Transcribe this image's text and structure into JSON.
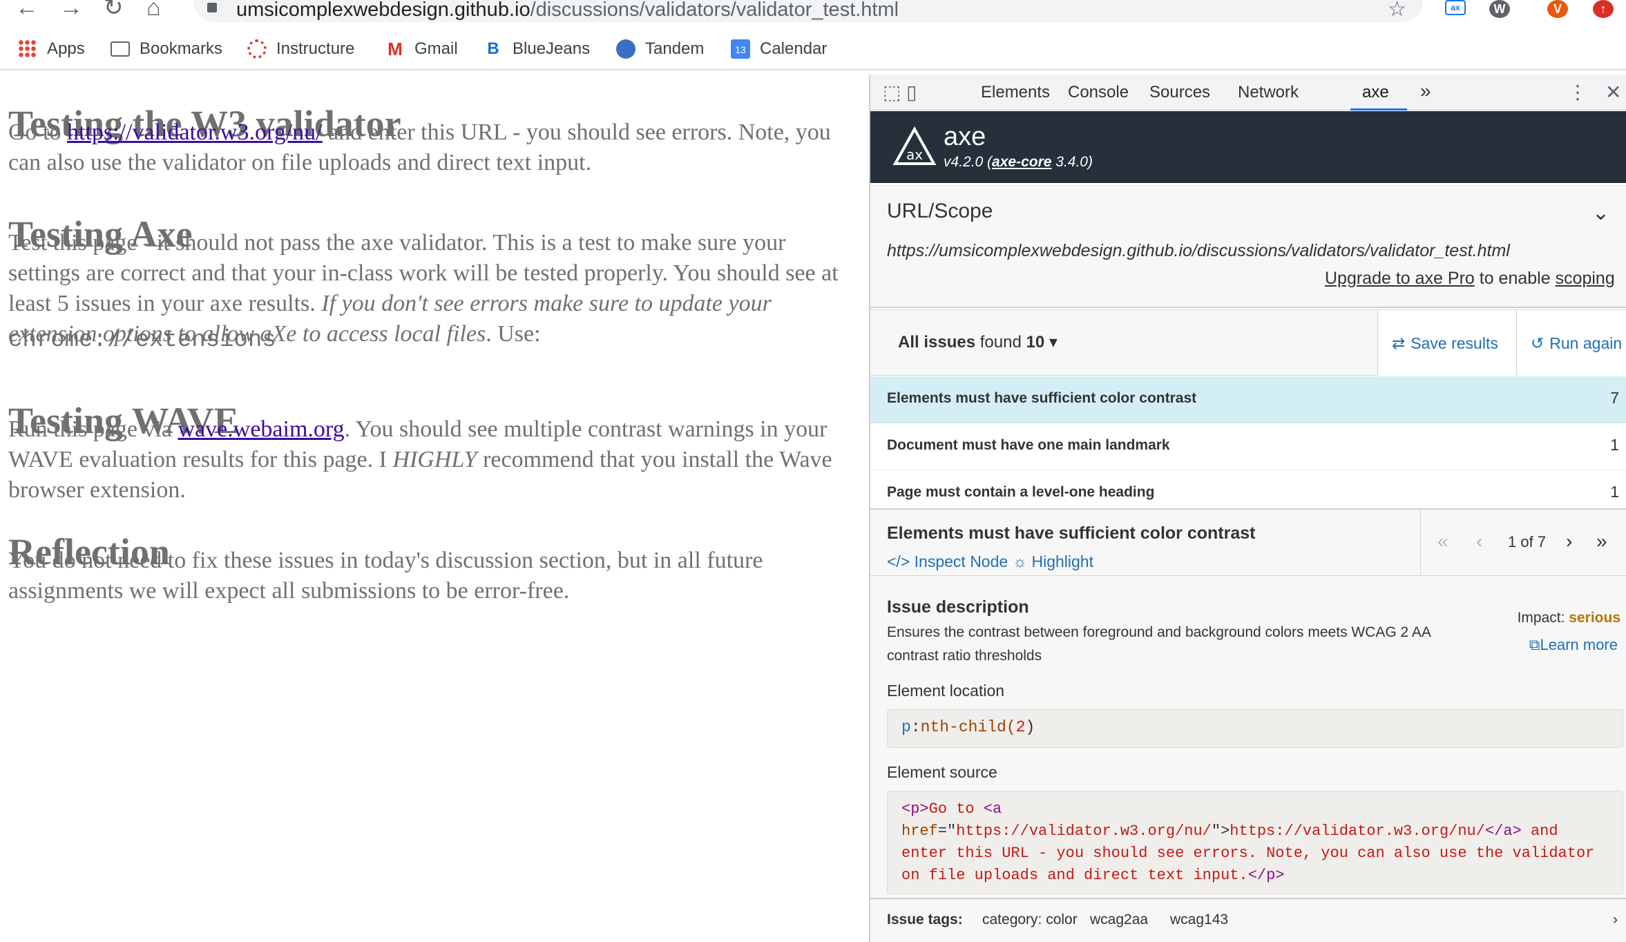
{
  "browser": {
    "url_host": "umsicomplexwebdesign.github.io",
    "url_path": "/discussions/validators/validator_test.html",
    "profile_initial": "V",
    "bookmarks": [
      {
        "label": "Apps",
        "icon": "apps-grid-icon"
      },
      {
        "label": "Bookmarks",
        "icon": "folder-icon"
      },
      {
        "label": "Instructure",
        "icon": "instructure-icon"
      },
      {
        "label": "Gmail",
        "icon": "gmail-icon"
      },
      {
        "label": "BlueJeans",
        "icon": "bluejeans-icon"
      },
      {
        "label": "Tandem",
        "icon": "tandem-icon"
      },
      {
        "label": "Calendar",
        "icon": "calendar-icon",
        "badge": "13"
      }
    ]
  },
  "page": {
    "sections": [
      {
        "heading": "Testing the W3 validator"
      },
      {
        "heading": "Testing Axe"
      },
      {
        "heading": "Testing WAVE"
      },
      {
        "heading": "Reflection"
      }
    ],
    "p1_pre": "Go to ",
    "p1_link": "https://validator.w3.org/nu/",
    "p1_post": " and enter this URL - you should see errors. Note, you can also use the validator on file uploads and direct text input.",
    "p2_pre": "Test this page - it should not pass the axe validator. This is a test to make sure your settings are correct and that your in-class work will be tested properly. You should see at least 5 issues in your axe results. ",
    "p2_em": "If you don't see errors make sure to update your extension options to allow aXe to access local files",
    "p2_post": ". Use:",
    "code": "chrome://extensions",
    "p3_pre": "Run this page via ",
    "p3_link": "wave.webaim.org",
    "p3_mid": ". You should see multiple contrast warnings in your WAVE evaluation results for this page. I ",
    "p3_em": "HIGHLY",
    "p3_post": " recommend that you install the Wave browser extension.",
    "p4": "You do not need to fix these issues in today's discussion section, but in all future assignments we will expect all submissions to be error-free."
  },
  "devtools": {
    "tabs": [
      "Elements",
      "Console",
      "Sources",
      "Network",
      "axe"
    ],
    "active_tab": "axe",
    "more_tabs": "»"
  },
  "axe": {
    "title": "axe",
    "version": "v4.2.0 (",
    "core_link": "axe-core",
    "core_version": " 3.4.0)",
    "scope_title": "URL/Scope",
    "scope_url": "https://umsicomplexwebdesign.github.io/discussions/validators/validator_test.html",
    "upgrade_link": "Upgrade to axe Pro",
    "upgrade_mid": " to enable ",
    "upgrade_scoping": "scoping",
    "issues_label": "All issues",
    "issues_found": " found ",
    "issues_count": "10",
    "save_label": "Save results",
    "run_label": "Run again",
    "issues": [
      {
        "label": "Elements must have sufficient color contrast",
        "count": "7"
      },
      {
        "label": "Document must have one main landmark",
        "count": "1"
      },
      {
        "label": "Page must contain a level-one heading",
        "count": "1"
      }
    ],
    "detail": {
      "title": "Elements must have sufficient color contrast",
      "inspect": "Inspect Node",
      "highlight": "Highlight",
      "pager": "1 of 7",
      "desc_title": "Issue description",
      "desc_text": "Ensures the contrast between foreground and background colors meets WCAG 2 AA contrast ratio thresholds",
      "impact_label": "Impact: ",
      "impact_value": "serious",
      "learn_more": "Learn more",
      "loc_label": "Element location",
      "loc_tag": "p",
      "loc_colon": ":",
      "loc_pseudo": "nth-child(",
      "loc_num": "2",
      "loc_close": ")",
      "src_label": "Element source",
      "src_tag_open": "<p>",
      "src_text1": "Go to ",
      "src_a_open": "<a",
      "src_attr": "href",
      "src_eq": "=\"",
      "src_attr_val": "https://validator.w3.org/nu/",
      "src_close_quote": "\">",
      "src_link_text": "https://validator.w3.org/nu/",
      "src_a_close": "</a>",
      "src_text2": " and enter this URL - you should see errors. Note, you can also use the validator on file uploads and direct text input.",
      "src_p_close": "</p>",
      "tags_label": "Issue tags:",
      "tags": [
        "category: color",
        "wcag2aa",
        "wcag143"
      ]
    },
    "colors": {
      "header_bg": "#25303a",
      "link": "#1e6fb4",
      "selected_row": "#d4eef5",
      "impact_serious": "#b87300"
    }
  }
}
